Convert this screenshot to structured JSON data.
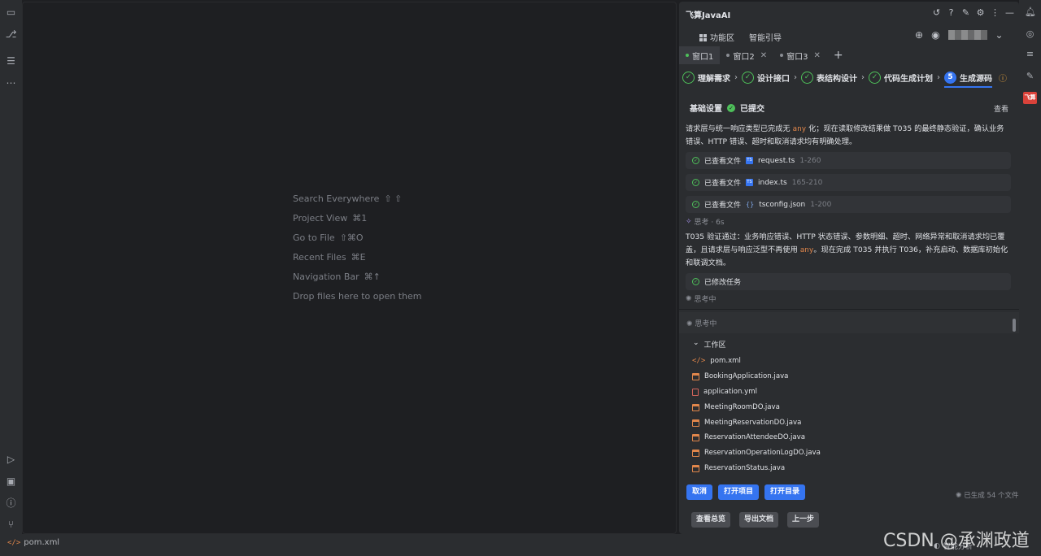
{
  "editor": {
    "hints": [
      {
        "label": "Search Everywhere",
        "key": "⇧ ⇧"
      },
      {
        "label": "Project View",
        "key": "⌘1"
      },
      {
        "label": "Go to File",
        "key": "⇧⌘O"
      },
      {
        "label": "Recent Files",
        "key": "⌘E"
      },
      {
        "label": "Navigation Bar",
        "key": "⌘↑"
      },
      {
        "label": "Drop files here to open them",
        "key": ""
      }
    ]
  },
  "status_bar": {
    "file": "pom.xml",
    "right_text": "智能分析",
    "watermark": "CSDN @承渊政道"
  },
  "panel": {
    "title": "飞算JavaAI",
    "menu": {
      "function_area": "功能区",
      "smart_guide": "智能引导"
    },
    "tabs": [
      {
        "label": "窗口1",
        "active": true
      },
      {
        "label": "窗口2",
        "active": false
      },
      {
        "label": "窗口3",
        "active": false
      }
    ],
    "steps": [
      {
        "label": "理解需求"
      },
      {
        "label": "设计接口"
      },
      {
        "label": "表结构设计"
      },
      {
        "label": "代码生成计划"
      },
      {
        "label": "生成源码",
        "number": "5"
      }
    ],
    "basic_settings": "基础设置",
    "submitted": "已提交",
    "view": "查看",
    "para1_a": "请求层与统一响应类型已完成无 ",
    "para1_code": "any",
    "para1_b": " 化；现在读取修改结果做 T035 的最终静态验证，确认业务错误、HTTP 错误、超时和取消请求均有明确处理。",
    "viewed_label": "已查看文件",
    "files": [
      {
        "name": "request.ts",
        "range": "1-260",
        "kind": "ts"
      },
      {
        "name": "index.ts",
        "range": "165-210",
        "kind": "ts"
      },
      {
        "name": "tsconfig.json",
        "range": "1-200",
        "kind": "json"
      }
    ],
    "think_done": "思考 · 6s",
    "para2_a": "T035 验证通过：业务响应错误、HTTP 状态错误、参数明细、超时、网络异常和取消请求均已覆盖，且请求层与响应泛型不再使用 ",
    "para2_code": "any",
    "para2_b": "。现在完成 T035 并执行 T036，补充启动、数据库初始化和联调文档。",
    "modified_task": "已修改任务",
    "thinking": "思考中",
    "thinking2": "思考中",
    "workspace": "工作区",
    "workspace_files": [
      {
        "name": "pom.xml",
        "kind": "xml"
      },
      {
        "name": "BookingApplication.java",
        "kind": "java"
      },
      {
        "name": "application.yml",
        "kind": "yml"
      },
      {
        "name": "MeetingRoomDO.java",
        "kind": "java"
      },
      {
        "name": "MeetingReservationDO.java",
        "kind": "java"
      },
      {
        "name": "ReservationAttendeeDO.java",
        "kind": "java"
      },
      {
        "name": "ReservationOperationLogDO.java",
        "kind": "java"
      },
      {
        "name": "ReservationStatus.java",
        "kind": "java"
      }
    ],
    "buttons": {
      "cancel": "取消",
      "open_project": "打开项目",
      "open_dir": "打开目录"
    },
    "generated": "已生成 54 个文件",
    "buttons2": {
      "overview": "查看总览",
      "export_doc": "导出文档",
      "prev_step": "上一步"
    }
  }
}
